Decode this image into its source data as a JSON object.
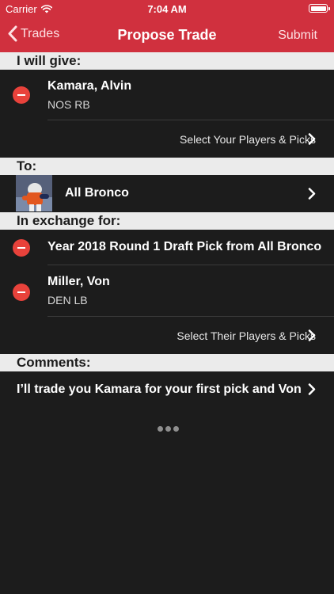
{
  "status_bar": {
    "carrier": "Carrier",
    "time": "7:04 AM"
  },
  "nav": {
    "back_label": "Trades",
    "title": "Propose Trade",
    "submit_label": "Submit"
  },
  "give_section": {
    "header": "I will give:",
    "players": [
      {
        "name": "Kamara, Alvin",
        "team_pos": "NOS RB"
      }
    ],
    "select_label": "Select Your Players & Picks"
  },
  "to_section": {
    "header": "To:",
    "team_name": "All Bronco"
  },
  "receive_section": {
    "header": "In exchange for:",
    "items": [
      {
        "name": "Year 2018 Round 1 Draft Pick from All Bronco",
        "team_pos": ""
      },
      {
        "name": "Miller, Von",
        "team_pos": "DEN LB"
      }
    ],
    "select_label": "Select Their Players & Picks"
  },
  "comments_section": {
    "header": "Comments:",
    "text": "I’ll trade you Kamara for your first pick and Von"
  },
  "colors": {
    "header_red": "#d0303e",
    "remove_red": "#e8423b",
    "background": "#1c1c1c",
    "section_header_bg": "#ebebeb"
  },
  "icons": [
    "wifi-icon",
    "battery-icon",
    "back-chevron-icon",
    "remove-icon",
    "chevron-right-icon",
    "more-icon"
  ]
}
